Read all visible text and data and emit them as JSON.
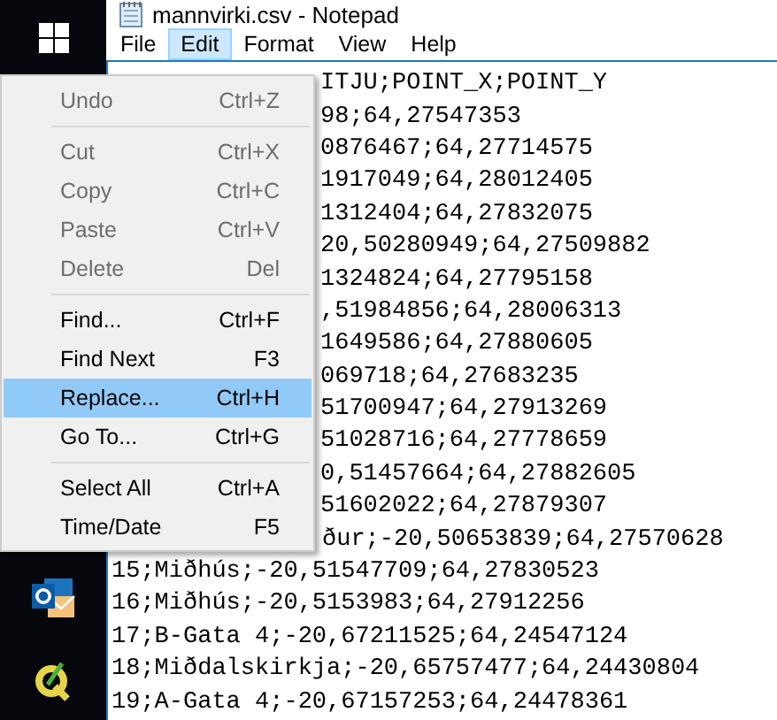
{
  "window": {
    "title": "mannvirki.csv - Notepad"
  },
  "menu_bar": [
    {
      "label": "File",
      "selected": false
    },
    {
      "label": "Edit",
      "selected": true
    },
    {
      "label": "Format",
      "selected": false
    },
    {
      "label": "View",
      "selected": false
    },
    {
      "label": "Help",
      "selected": false
    }
  ],
  "edit_menu": [
    {
      "kind": "item",
      "label": "Undo",
      "shortcut": "Ctrl+Z",
      "disabled": true,
      "selected": false
    },
    {
      "kind": "separator"
    },
    {
      "kind": "item",
      "label": "Cut",
      "shortcut": "Ctrl+X",
      "disabled": true,
      "selected": false
    },
    {
      "kind": "item",
      "label": "Copy",
      "shortcut": "Ctrl+C",
      "disabled": true,
      "selected": false
    },
    {
      "kind": "item",
      "label": "Paste",
      "shortcut": "Ctrl+V",
      "disabled": true,
      "selected": false
    },
    {
      "kind": "item",
      "label": "Delete",
      "shortcut": "Del",
      "disabled": true,
      "selected": false
    },
    {
      "kind": "separator"
    },
    {
      "kind": "item",
      "label": "Find...",
      "shortcut": "Ctrl+F",
      "disabled": false,
      "selected": false
    },
    {
      "kind": "item",
      "label": "Find Next",
      "shortcut": "F3",
      "disabled": false,
      "selected": false
    },
    {
      "kind": "item",
      "label": "Replace...",
      "shortcut": "Ctrl+H",
      "disabled": false,
      "selected": true
    },
    {
      "kind": "item",
      "label": "Go To...",
      "shortcut": "Ctrl+G",
      "disabled": false,
      "selected": false
    },
    {
      "kind": "separator"
    },
    {
      "kind": "item",
      "label": "Select All",
      "shortcut": "Ctrl+A",
      "disabled": false,
      "selected": false
    },
    {
      "kind": "item",
      "label": "Time/Date",
      "shortcut": "F5",
      "disabled": false,
      "selected": false
    }
  ],
  "document": {
    "lines": [
      {
        "kind": "covered",
        "text": "ITJU;POINT_X;POINT_Y"
      },
      {
        "kind": "covered",
        "text": "98;64,27547353"
      },
      {
        "kind": "covered",
        "text": "0876467;64,27714575"
      },
      {
        "kind": "covered",
        "text": "1917049;64,28012405"
      },
      {
        "kind": "covered",
        "text": "1312404;64,27832075"
      },
      {
        "kind": "covered",
        "text": "20,50280949;64,27509882"
      },
      {
        "kind": "covered",
        "text": "1324824;64,27795158"
      },
      {
        "kind": "covered",
        "text": ",51984856;64,28006313"
      },
      {
        "kind": "covered",
        "text": "1649586;64,27880605"
      },
      {
        "kind": "covered",
        "text": "069718;64,27683235"
      },
      {
        "kind": "covered",
        "text": "51700947;64,27913269"
      },
      {
        "kind": "covered",
        "text": "51028716;64,27778659"
      },
      {
        "kind": "covered",
        "text": "0,51457664;64,27882605"
      },
      {
        "kind": "covered",
        "text": "51602022;64,27879307"
      },
      {
        "kind": "cut",
        "text": "ður;-20,50653839;64,27570628"
      },
      {
        "kind": "full",
        "text": "15;Miðhús;-20,51547709;64,27830523"
      },
      {
        "kind": "full",
        "text": "16;Miðhús;-20,5153983;64,27912256"
      },
      {
        "kind": "full",
        "text": "17;B-Gata 4;-20,67211525;64,24547124"
      },
      {
        "kind": "full",
        "text": "18;Miðdalskirkja;-20,65757477;64,24430804"
      },
      {
        "kind": "full",
        "text": "19;A-Gata 4;-20,67157253;64,24478361"
      }
    ]
  }
}
